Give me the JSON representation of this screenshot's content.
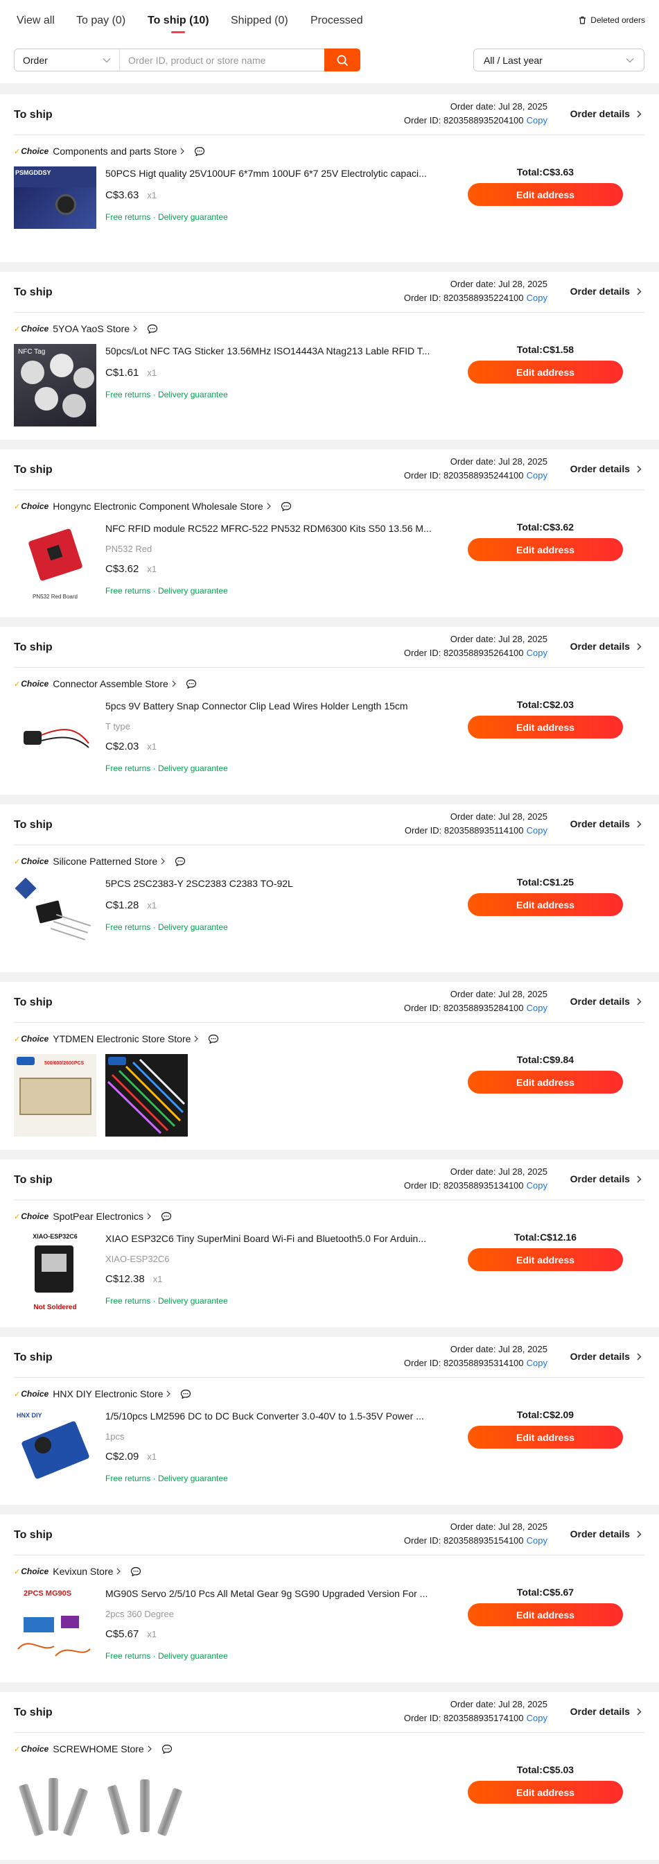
{
  "tabs": [
    {
      "label": "View all"
    },
    {
      "label": "To pay (0)"
    },
    {
      "label": "To ship (10)"
    },
    {
      "label": "Shipped (0)"
    },
    {
      "label": "Processed"
    }
  ],
  "deleted_orders": "Deleted orders",
  "search": {
    "type_value": "Order",
    "placeholder": "Order ID, product or store name"
  },
  "time_filter": "All / Last year",
  "labels": {
    "status": "To ship",
    "order_date_prefix": "Order date: ",
    "order_id_prefix": "Order ID: ",
    "copy": "Copy",
    "details": "Order details",
    "choice": "Choice",
    "total_prefix": "Total:",
    "edit_address": "Edit address",
    "free_returns": "Free returns · Delivery guarantee"
  },
  "colors": {
    "accent": "#fd4f00",
    "button_gradient_start": "#ff5a00",
    "button_gradient_end": "#fe2c2b",
    "link": "#1a73e8",
    "guarantee_green": "#00a350",
    "choice_check": "#f5a300"
  },
  "orders": [
    {
      "date": "Jul 28, 2025",
      "id": "8203588935204100",
      "store": "Components and parts Store",
      "title": "50PCS Higt quality 25V100UF 6*7mm 100UF 6*7 25V Electrolytic capaci...",
      "sku": "",
      "price": "C$3.63",
      "qty": "x1",
      "total": "C$3.63",
      "images": [
        {
          "text": "PSMGDDSY"
        }
      ]
    },
    {
      "date": "Jul 28, 2025",
      "id": "8203588935224100",
      "store": "5YOA YaoS Store",
      "title": "50pcs/Lot NFC TAG Sticker 13.56MHz ISO14443A Ntag213 Lable RFID T...",
      "sku": "",
      "price": "C$1.61",
      "qty": "x1",
      "total": "C$1.58",
      "images": [
        {
          "text": "NFC Tag"
        }
      ]
    },
    {
      "date": "Jul 28, 2025",
      "id": "8203588935244100",
      "store": "Hongync Electronic Component Wholesale Store",
      "title": "NFC RFID module RC522 MFRC-522 PN532 RDM6300 Kits S50 13.56 M...",
      "sku": "PN532 Red",
      "price": "C$3.62",
      "qty": "x1",
      "total": "C$3.62",
      "images": [
        {
          "text": "PN532 Red Board"
        }
      ]
    },
    {
      "date": "Jul 28, 2025",
      "id": "8203588935264100",
      "store": "Connector Assemble Store",
      "title": "5pcs 9V Battery Snap Connector Clip Lead Wires Holder Length 15cm",
      "sku": "T type",
      "price": "C$2.03",
      "qty": "x1",
      "total": "C$2.03",
      "images": [
        {
          "text": ""
        }
      ]
    },
    {
      "date": "Jul 28, 2025",
      "id": "8203588935114100",
      "store": "Silicone Patterned Store",
      "title": "5PCS 2SC2383-Y 2SC2383 C2383 TO-92L",
      "sku": "",
      "price": "C$1.28",
      "qty": "x1",
      "total": "C$1.25",
      "images": [
        {
          "text": ""
        }
      ]
    },
    {
      "date": "Jul 28, 2025",
      "id": "8203588935284100",
      "store": "YTDMEN Electronic Store Store",
      "title": "",
      "sku": "",
      "price": "",
      "qty": "",
      "total": "C$9.84",
      "images": [
        {
          "text": "500/600/2600PCS"
        },
        {
          "text": ""
        }
      ]
    },
    {
      "date": "Jul 28, 2025",
      "id": "8203588935134100",
      "store": "SpotPear Electronics",
      "title": "XIAO ESP32C6 Tiny SuperMini Board Wi-Fi and Bluetooth5.0 For Arduin...",
      "sku": "XIAO-ESP32C6",
      "price": "C$12.38",
      "qty": "x1",
      "total": "C$12.16",
      "images": [
        {
          "text": "XIAO-ESP32C6"
        }
      ]
    },
    {
      "date": "Jul 28, 2025",
      "id": "8203588935314100",
      "store": "HNX DIY Electronic Store",
      "title": "1/5/10pcs LM2596 DC to DC Buck Converter 3.0-40V to 1.5-35V Power ...",
      "sku": "1pcs",
      "price": "C$2.09",
      "qty": "x1",
      "total": "C$2.09",
      "images": [
        {
          "text": "HNX DIY"
        }
      ]
    },
    {
      "date": "Jul 28, 2025",
      "id": "8203588935154100",
      "store": "Kevixun Store",
      "title": "MG90S Servo 2/5/10 Pcs All Metal Gear 9g SG90 Upgraded Version For ...",
      "sku": "2pcs 360 Degree",
      "price": "C$5.67",
      "qty": "x1",
      "total": "C$5.67",
      "images": [
        {
          "text": "2PCS MG90S"
        }
      ]
    },
    {
      "date": "Jul 28, 2025",
      "id": "8203588935174100",
      "store": "SCREWHOME Store",
      "title": "",
      "sku": "",
      "price": "",
      "qty": "",
      "total": "C$5.03",
      "images": [
        {
          "text": ""
        },
        {
          "text": ""
        }
      ]
    }
  ]
}
